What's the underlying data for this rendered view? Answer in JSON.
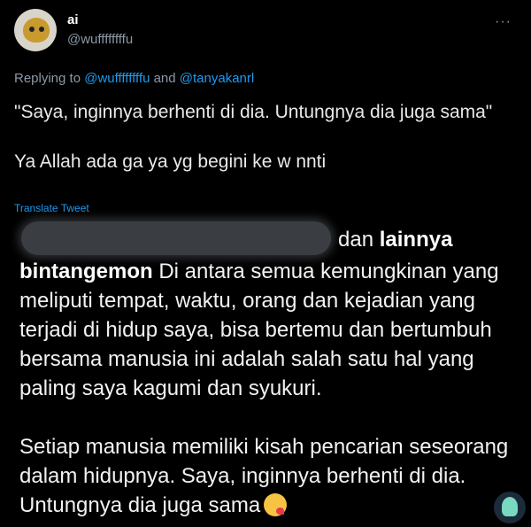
{
  "tweet": {
    "author_name": "ai",
    "author_handle": "@wuffffffffu",
    "more_label": "···",
    "reply_prefix": "Replying to ",
    "reply_mention_1": "@wuffffffffu",
    "reply_and": " and ",
    "reply_mention_2": "@tanyakanrl",
    "body": "\"Saya, inginnya berhenti di dia. Untungnya dia juga sama\"\n\nYa Allah ada ga ya yg begini ke w nnti",
    "translate_label": "Translate Tweet"
  },
  "quoted": {
    "line1_suffix": "dan ",
    "line1_bold": "lainnya",
    "line2_bold": "bintangemon",
    "line2_rest": " Di antara semua kemungkinan yang",
    "line3": "meliputi tempat, waktu, orang dan kejadian yang",
    "line4": "terjadi di hidup saya, bisa bertemu dan bertumbuh",
    "line5": "bersama manusia ini adalah salah satu hal yang",
    "line6": "paling saya kagumi dan syukuri.",
    "line7": "Setiap manusia memiliki kisah pencarian seseorang",
    "line8": "dalam hidupnya. Saya, inginnya berhenti di dia.",
    "line9": "Untungnya dia juga sama"
  },
  "icons": {
    "avatar": "cartoon-avatar",
    "more": "more-options-icon",
    "emoji": "face-blowing-kiss-emoji",
    "sticker": "sticker-icon"
  }
}
